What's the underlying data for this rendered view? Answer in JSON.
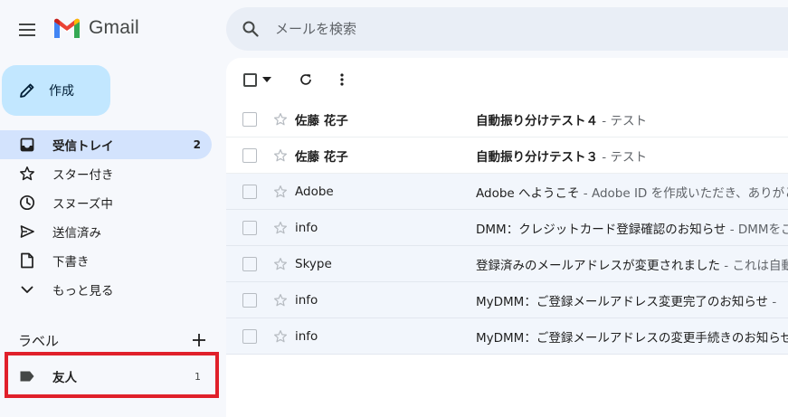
{
  "app": {
    "name": "Gmail"
  },
  "search": {
    "placeholder": "メールを検索"
  },
  "compose": {
    "label": "作成"
  },
  "nav": {
    "items": [
      {
        "label": "受信トレイ",
        "count": "2",
        "icon": "inbox-icon",
        "active": true
      },
      {
        "label": "スター付き",
        "count": "",
        "icon": "star-icon"
      },
      {
        "label": "スヌーズ中",
        "count": "",
        "icon": "clock-icon"
      },
      {
        "label": "送信済み",
        "count": "",
        "icon": "send-icon"
      },
      {
        "label": "下書き",
        "count": "",
        "icon": "draft-icon"
      },
      {
        "label": "もっと見る",
        "count": "",
        "icon": "chevron-down-icon"
      }
    ]
  },
  "labels": {
    "title": "ラベル",
    "items": [
      {
        "label": "友人",
        "count": "1",
        "icon": "label-icon"
      }
    ]
  },
  "mails": [
    {
      "sender": "佐藤 花子",
      "subject": "自動振り分けテスト４",
      "snippet": " - テスト",
      "unread": true
    },
    {
      "sender": "佐藤 花子",
      "subject": "自動振り分けテスト３",
      "snippet": " - テスト",
      "unread": true
    },
    {
      "sender": "Adobe",
      "subject": "Adobe へようこそ",
      "snippet": " - Adobe ID を作成いただき、ありがとう",
      "unread": false
    },
    {
      "sender": "info",
      "subject": "DMM：クレジットカード登録確認のお知らせ",
      "snippet": " - DMMをご",
      "unread": false
    },
    {
      "sender": "Skype",
      "subject": "登録済みのメールアドレスが変更されました",
      "snippet": " - これは自動",
      "unread": false
    },
    {
      "sender": "info",
      "subject": "MyDMM：ご登録メールアドレス変更完了のお知らせ",
      "snippet": " - ",
      "unread": false
    },
    {
      "sender": "info",
      "subject": "MyDMM：ご登録メールアドレスの変更手続きのお知らせ",
      "snippet": "",
      "unread": false
    }
  ],
  "colors": {
    "accent": "#c2e7ff",
    "active_nav": "#d3e3fd",
    "highlight_box": "#e0202a"
  }
}
